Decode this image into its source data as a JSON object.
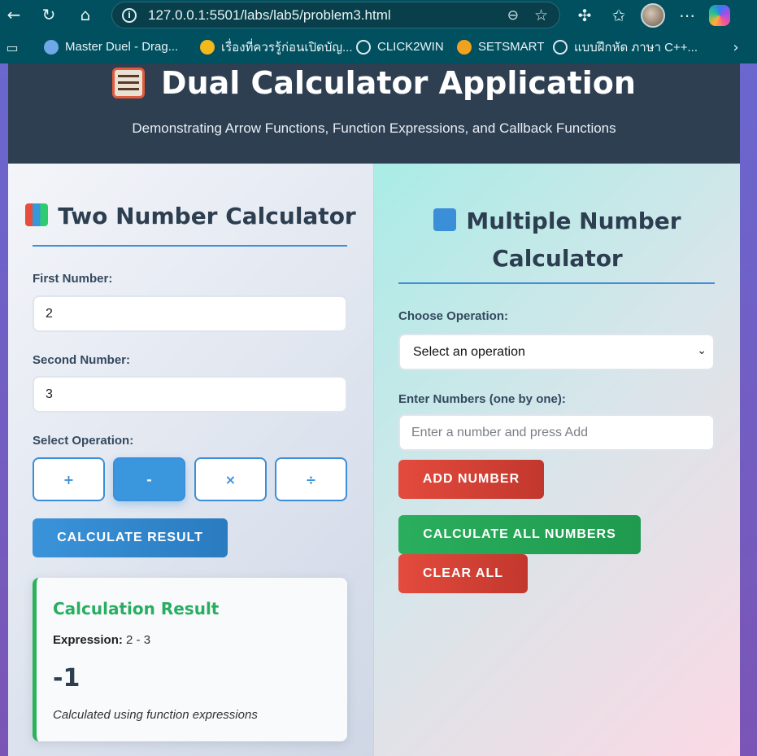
{
  "browser": {
    "url": "127.0.0.1:5501/labs/lab5/problem3.html",
    "bookmarks": [
      {
        "label": "Master Duel - Drag...",
        "color": "#6ea8e6"
      },
      {
        "label": "เรื่องที่ควรรู้ก่อนเปิดบัญ...",
        "color": "#f2b81c"
      },
      {
        "label": "CLICK2WIN",
        "color": "#dfe9ee"
      },
      {
        "label": "SETSMART",
        "color": "#f0a21e"
      },
      {
        "label": "แบบฝึกหัด ภาษา C++...",
        "color": "#dfe9ee"
      }
    ]
  },
  "header": {
    "title": "Dual Calculator Application",
    "subtitle": "Demonstrating Arrow Functions, Function Expressions, and Callback Functions"
  },
  "two_number": {
    "heading": "Two Number Calculator",
    "first_label": "First Number:",
    "first_value": "2",
    "second_label": "Second Number:",
    "second_value": "3",
    "operation_label": "Select Operation:",
    "operations": [
      "+",
      "-",
      "×",
      "÷"
    ],
    "active_operation": "-",
    "calculate_label": "Calculate Result",
    "result": {
      "title": "Calculation Result",
      "expression_label": "Expression:",
      "expression": "2 - 3",
      "value": "-1",
      "note": "Calculated using function expressions"
    }
  },
  "multiple_number": {
    "heading_line1": "Multiple Number",
    "heading_line2": "Calculator",
    "operation_label": "Choose Operation:",
    "operation_selected": "Select an operation",
    "numbers_label": "Enter Numbers (one by one):",
    "numbers_placeholder": "Enter a number and press Add",
    "add_label": "Add Number",
    "calculate_all_label": "Calculate All Numbers",
    "clear_label": "Clear All"
  }
}
